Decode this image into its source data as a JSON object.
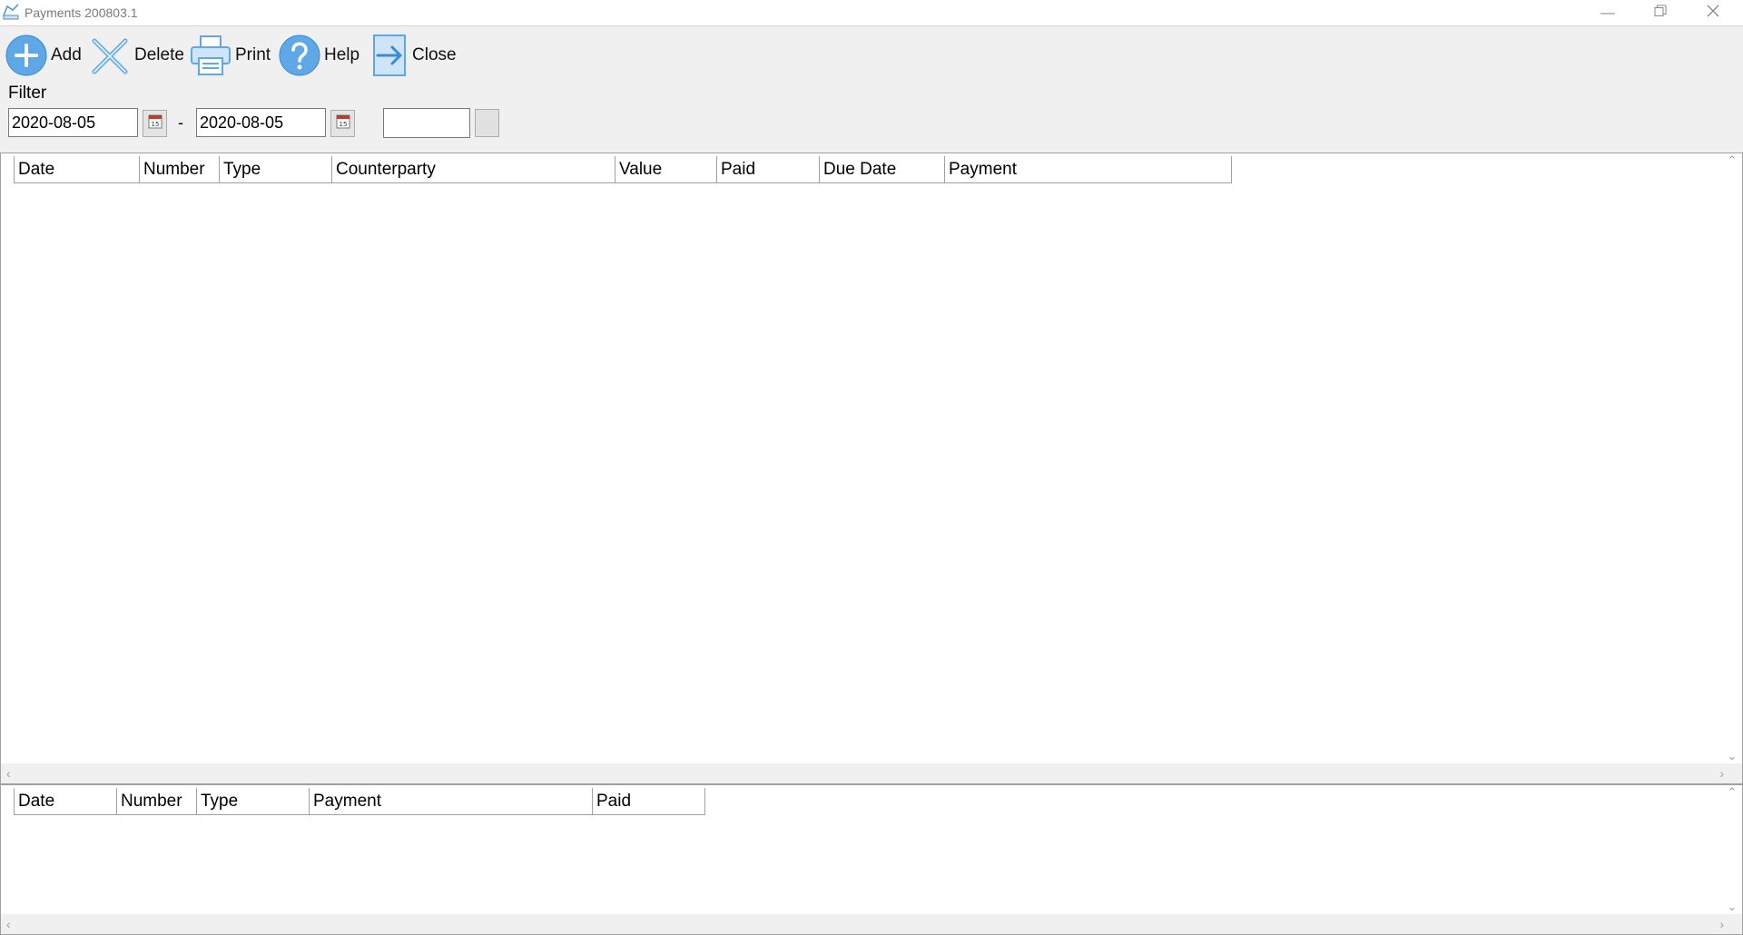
{
  "window": {
    "title": "Payments 200803.1"
  },
  "toolbar": {
    "add_label": "Add",
    "delete_label": "Delete",
    "print_label": "Print",
    "help_label": "Help",
    "close_label": "Close"
  },
  "filter": {
    "label": "Filter",
    "date_from": "2020-08-05",
    "date_to": "2020-08-05",
    "range_separator": "-",
    "text_value": ""
  },
  "payments_table": {
    "columns": [
      "Date",
      "Number",
      "Type",
      "Counterparty",
      "Value",
      "Paid",
      "Due Date",
      "Payment"
    ],
    "rows": []
  },
  "details_table": {
    "columns": [
      "Date",
      "Number",
      "Type",
      "Payment",
      "Paid"
    ],
    "rows": []
  },
  "colors": {
    "icon_blue": "#5ea8e8",
    "icon_light": "#cfe4f7",
    "background": "#f0f0f0"
  }
}
